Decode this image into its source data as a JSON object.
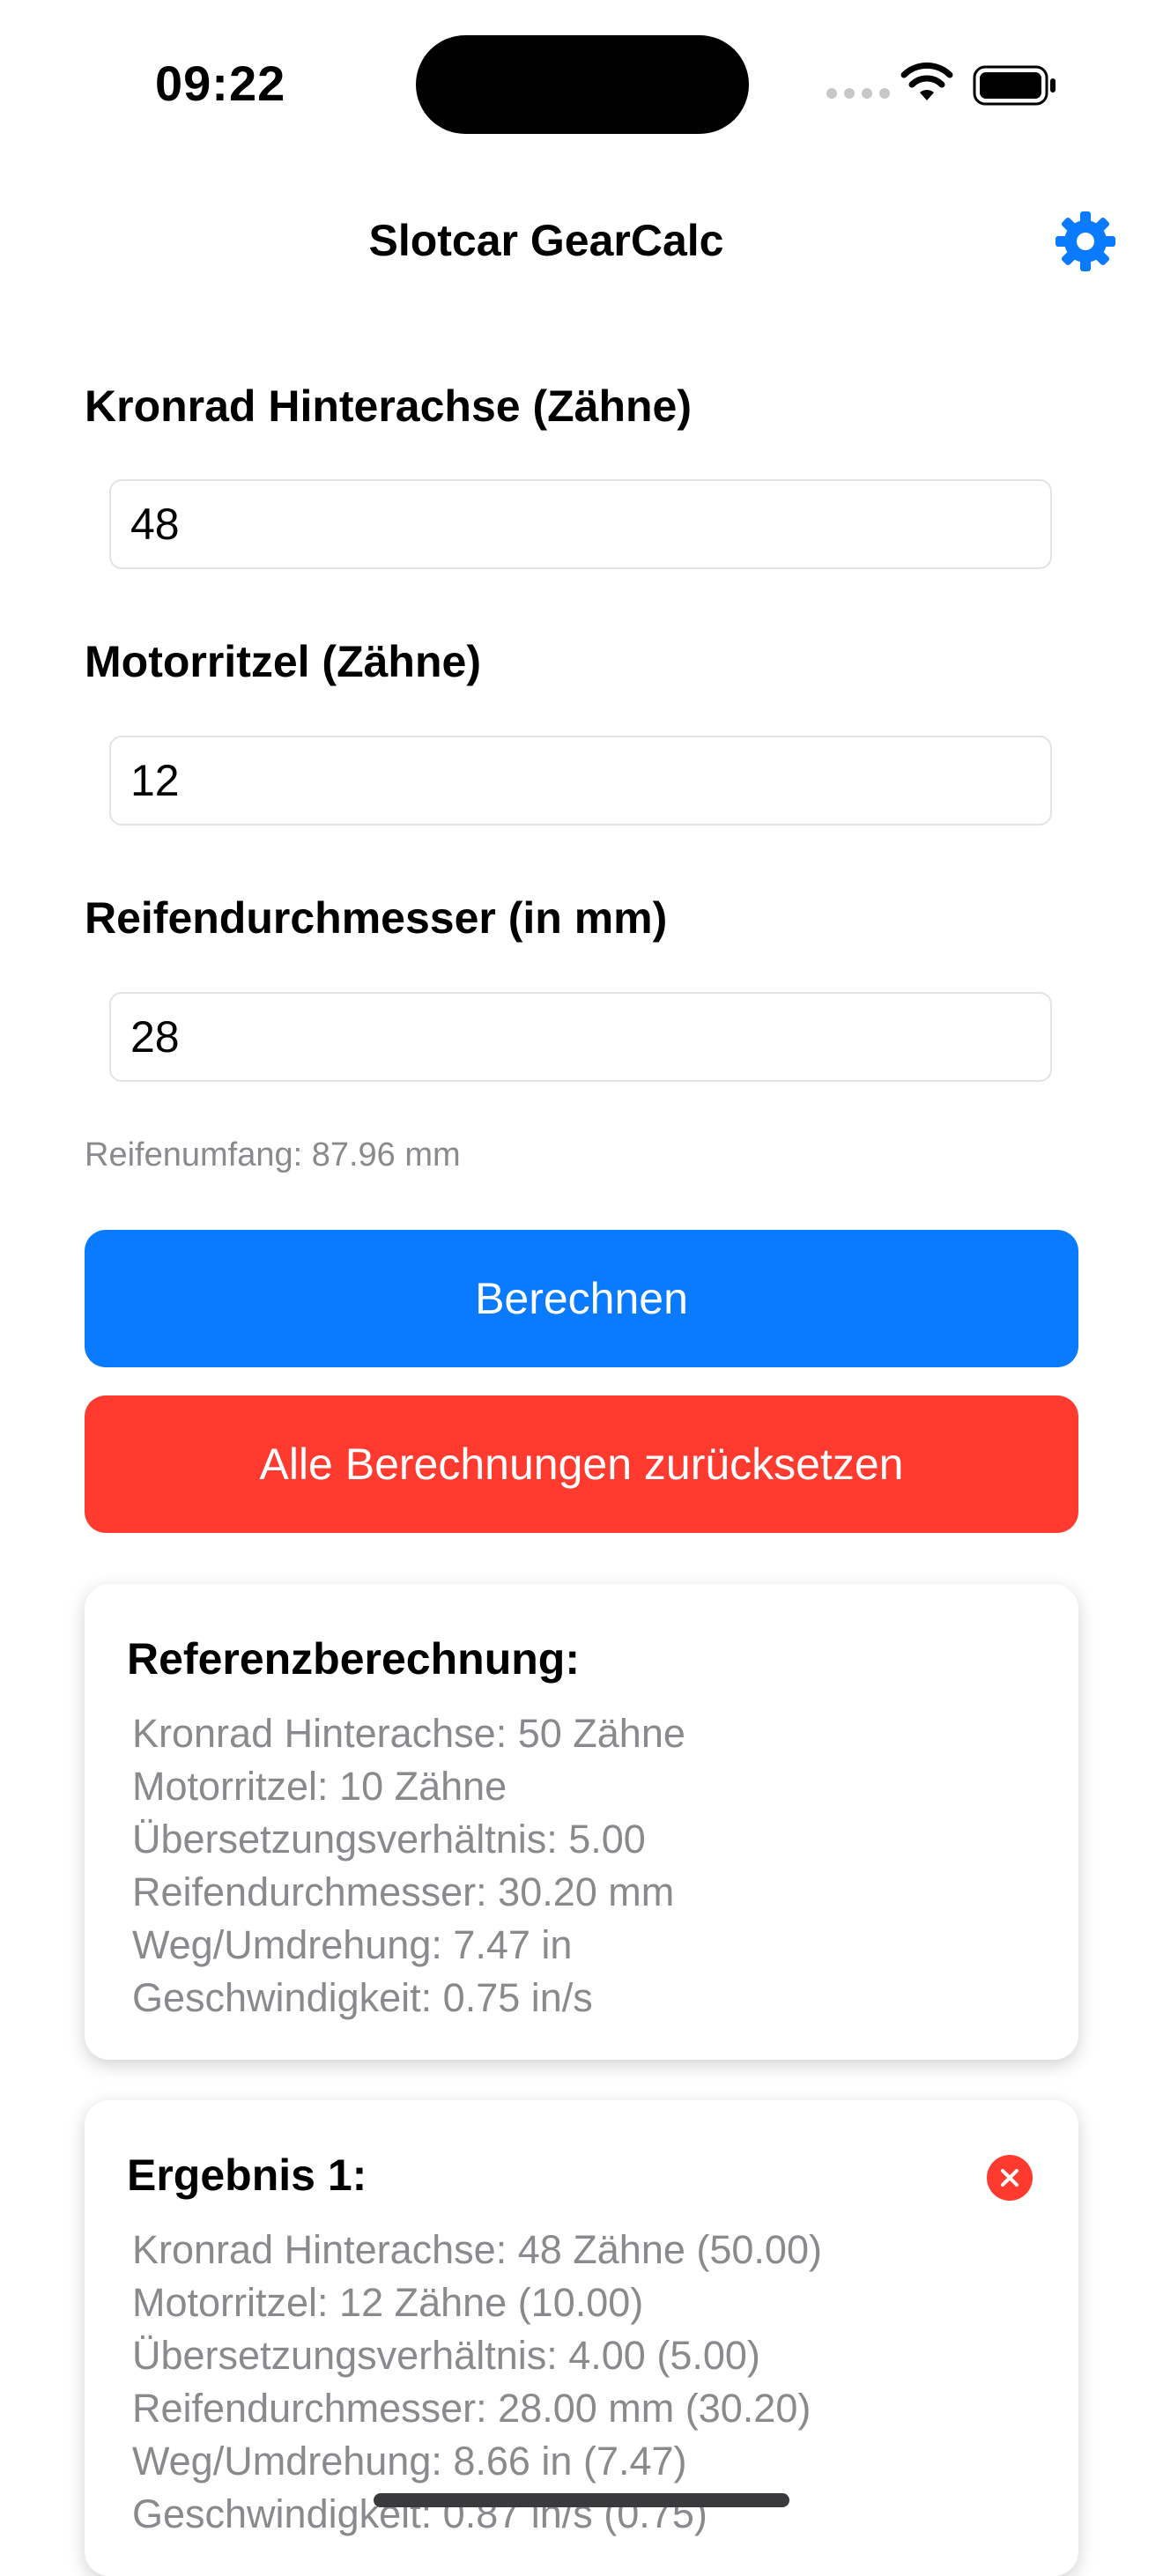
{
  "status_bar": {
    "time": "09:22"
  },
  "nav": {
    "title": "Slotcar GearCalc",
    "settings_icon": "gear-icon",
    "accent": "#0a7aff"
  },
  "form": {
    "crown_label": "Kronrad Hinterachse (Zähne)",
    "crown_value": "48",
    "pinion_label": "Motorritzel (Zähne)",
    "pinion_value": "12",
    "tire_label": "Reifendurchmesser (in mm)",
    "tire_value": "28",
    "circumference_hint": "Reifenumfang: 87.96 mm"
  },
  "buttons": {
    "calculate": "Berechnen",
    "reset_all": "Alle Berechnungen zurücksetzen"
  },
  "reference": {
    "title": "Referenzberechnung:",
    "lines": [
      "Kronrad Hinterachse: 50 Zähne",
      "Motorritzel: 10 Zähne",
      "Übersetzungsverhältnis: 5.00",
      "Reifendurchmesser: 30.20 mm",
      "Weg/Umdrehung: 7.47 in",
      "Geschwindigkeit: 0.75 in/s"
    ]
  },
  "result1": {
    "title": "Ergebnis 1:",
    "delete_icon": "close-circle-icon",
    "lines": [
      "Kronrad Hinterachse: 48 Zähne (50.00)",
      "Motorritzel: 12 Zähne (10.00)",
      "Übersetzungsverhältnis: 4.00 (5.00)",
      "Reifendurchmesser: 28.00 mm (30.20)",
      "Weg/Umdrehung: 8.66 in (7.47)",
      "Geschwindigkeit: 0.87 in/s (0.75)"
    ]
  }
}
